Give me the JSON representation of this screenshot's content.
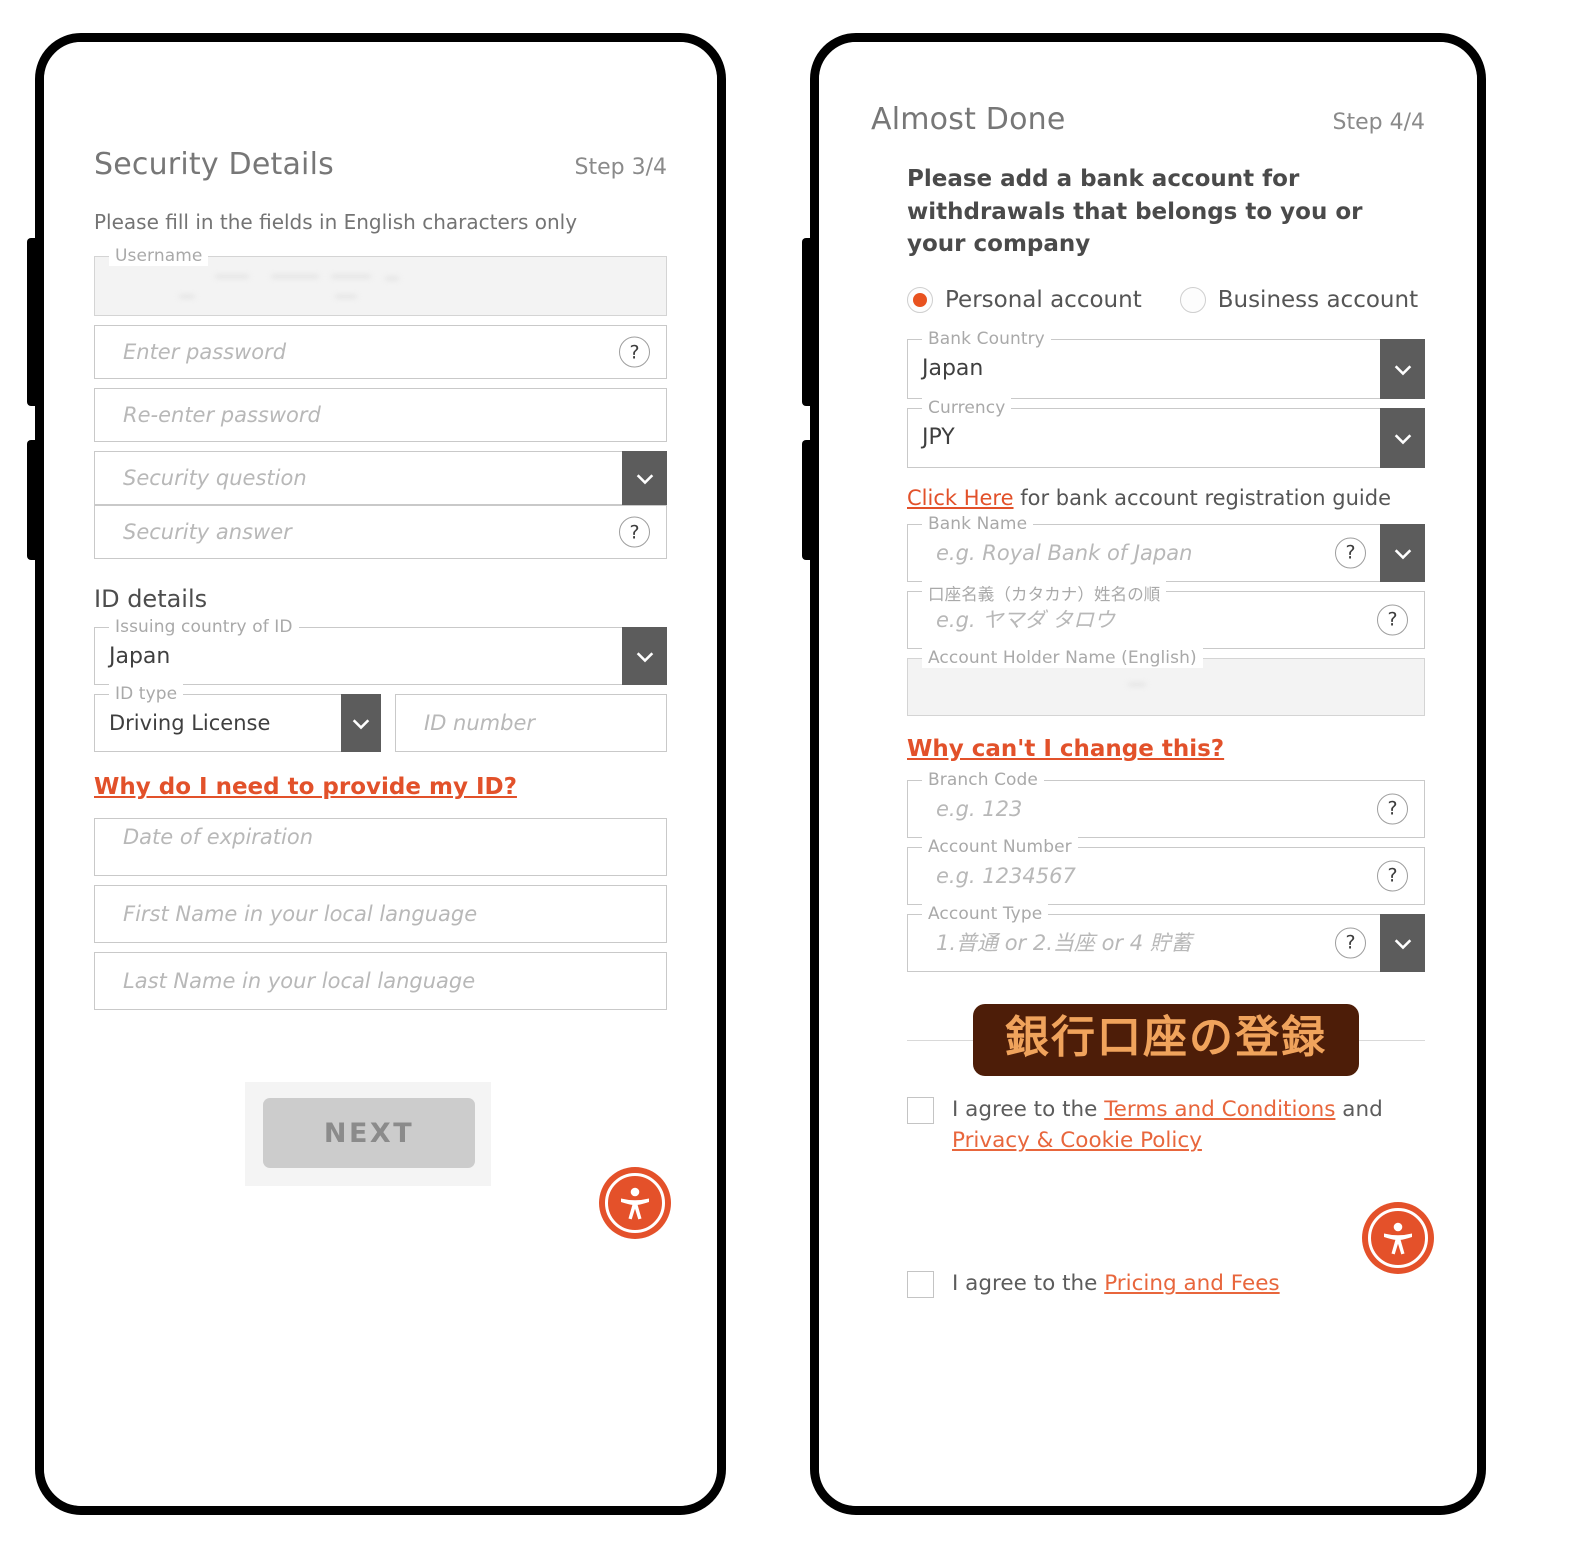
{
  "left_phone": {
    "header": {
      "title": "Security Details",
      "step": "Step 3/4"
    },
    "note": "Please fill in the fields in English characters only",
    "fields": {
      "username": {
        "legend": "Username",
        "value": ""
      },
      "password": {
        "placeholder": "Enter password",
        "help": "?"
      },
      "password_confirm": {
        "placeholder": "Re-enter password"
      },
      "security_question": {
        "placeholder": "Security question"
      },
      "security_answer": {
        "placeholder": "Security answer",
        "help": "?"
      }
    },
    "id_section": {
      "title": "ID details",
      "issuing_country": {
        "legend": "Issuing country of ID",
        "value": "Japan"
      },
      "id_type": {
        "legend": "ID type",
        "value": "Driving License"
      },
      "id_number": {
        "placeholder": "ID number"
      },
      "why_link": "Why do I need to provide my ID?",
      "expiration": {
        "placeholder": "Date of expiration"
      },
      "first_name": {
        "placeholder": "First Name in your local language"
      },
      "last_name": {
        "placeholder": "Last Name in your local language"
      }
    },
    "next_label": "NEXT"
  },
  "right_phone": {
    "header": {
      "title": "Almost Done",
      "step": "Step 4/4"
    },
    "lead": "Please add a bank account for withdrawals that belongs to you or your company",
    "account_type_options": [
      {
        "label": "Personal account",
        "selected": true
      },
      {
        "label": "Business account",
        "selected": false
      }
    ],
    "fields": {
      "bank_country": {
        "legend": "Bank Country",
        "value": "Japan"
      },
      "currency": {
        "legend": "Currency",
        "value": "JPY"
      },
      "bank_name": {
        "legend": "Bank Name",
        "placeholder": "e.g. Royal Bank of Japan",
        "help": "?"
      },
      "katakana_name": {
        "legend": "口座名義（カタカナ）姓名の順",
        "placeholder": "e.g. ヤマダ タロウ",
        "help": "?"
      },
      "holder_name_en": {
        "legend": "Account Holder Name (English)",
        "value": ""
      },
      "branch_code": {
        "legend": "Branch Code",
        "placeholder": "e.g. 123",
        "help": "?"
      },
      "account_number": {
        "legend": "Account Number",
        "placeholder": "e.g. 1234567",
        "help": "?"
      },
      "account_type": {
        "legend": "Account Type",
        "placeholder": "1.普通 or 2.当座 or 4 貯蓄",
        "help": "?"
      }
    },
    "guide": {
      "link": "Click Here",
      "text": " for bank account registration guide"
    },
    "why_link": "Why can't I change this?",
    "submit_label": "銀行口座の登録",
    "agreements": [
      {
        "prefix": "I agree to the ",
        "link1": "Terms and Conditions",
        "middle": " and ",
        "link2": "Privacy & Cookie Policy"
      },
      {
        "prefix": "I agree to the ",
        "link1": "Pricing and Fees"
      }
    ]
  },
  "icons": {
    "accessibility": "accessibility-icon",
    "chevron": "chevron-down-icon",
    "help": "help-icon"
  },
  "colors": {
    "accent_orange": "#e2512a",
    "submit_bg": "#4d1d08",
    "submit_fg": "#f0a35c",
    "dropdown_grey": "#5c5c5c"
  }
}
